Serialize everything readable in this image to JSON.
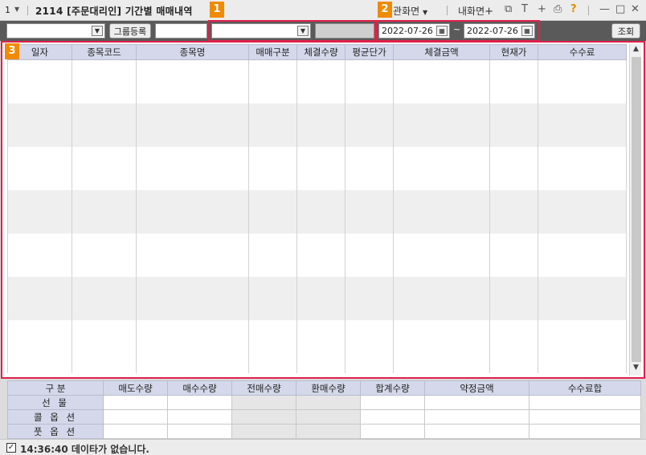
{
  "window": {
    "number": "1",
    "title": "2114 [주문대리인] 기간별 매매내역",
    "related_screen": "연관화면",
    "my_screen": "내화면"
  },
  "toolbar": {
    "group_register_label": "그룹등록",
    "date_from": "2022-07-26",
    "date_to": "2022-07-26",
    "tilde": "~",
    "search_label": "조회"
  },
  "badges": [
    "1",
    "2",
    "3"
  ],
  "grid": {
    "columns": [
      "일자",
      "종목코드",
      "종목명",
      "매매구분",
      "체결수량",
      "평균단가",
      "체결금액",
      "현재가",
      "수수료"
    ]
  },
  "summary": {
    "columns": [
      "구 분",
      "매도수량",
      "매수수량",
      "전매수량",
      "환매수량",
      "합계수량",
      "약정금액",
      "수수료합"
    ],
    "rows": [
      "선 물",
      "콜 옵 션",
      "풋 옵 션"
    ]
  },
  "status": {
    "time": "14:36:40",
    "message": "데이타가 없습니다."
  },
  "colors": {
    "highlight": "#e0204a",
    "badge": "#f08a00",
    "header_bg": "#d4d8ea"
  }
}
